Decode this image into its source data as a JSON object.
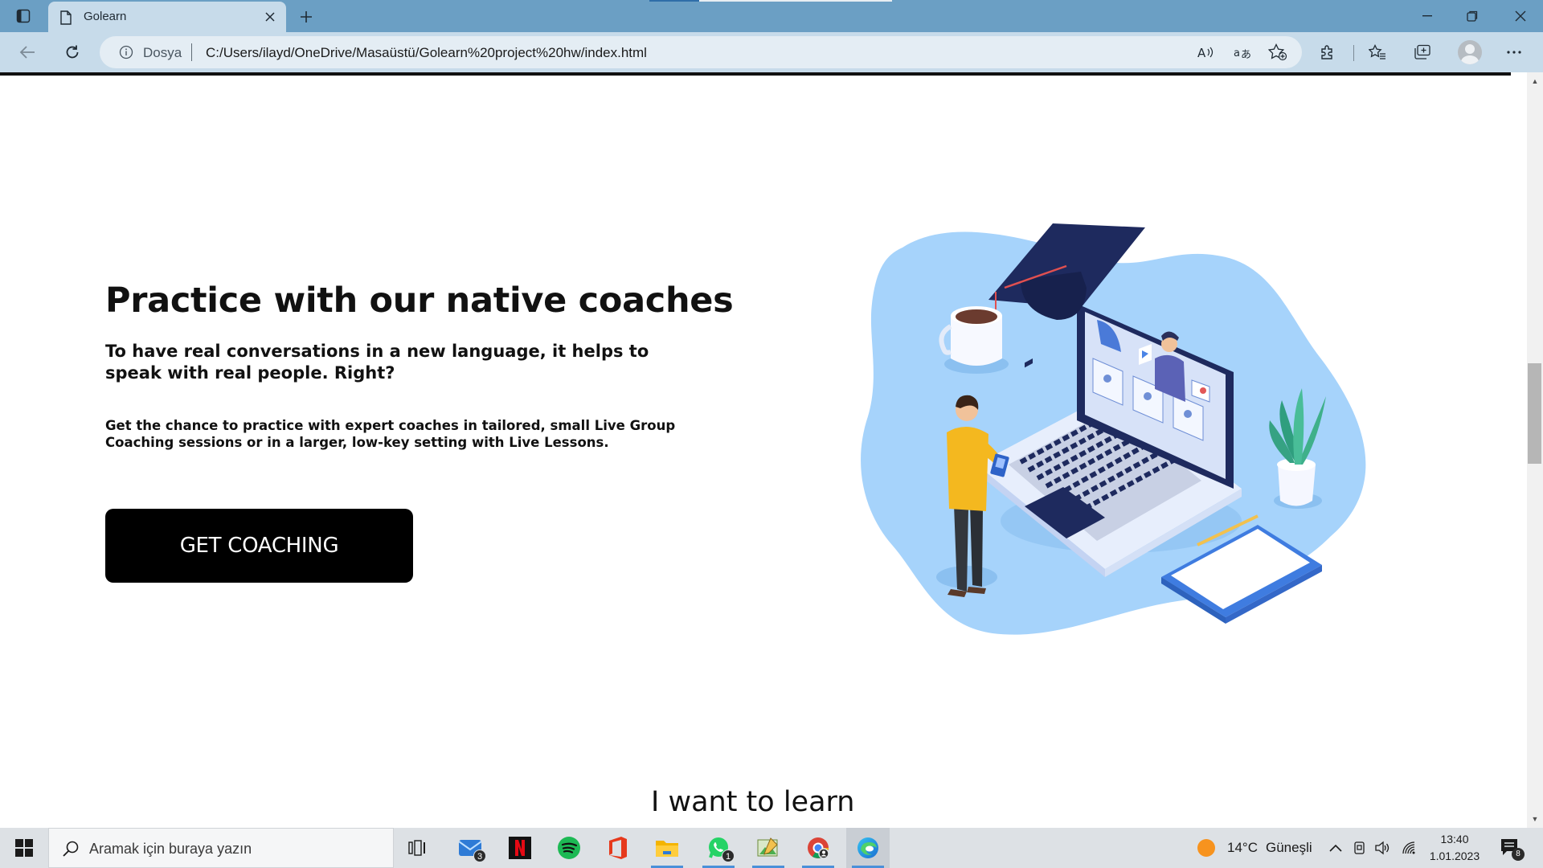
{
  "browser": {
    "tab_title": "Golearn",
    "address_scheme": "Dosya",
    "address_url": "C:/Users/ilayd/OneDrive/Masaüstü/Golearn%20project%20hw/index.html",
    "icons": [
      "tab-actions-icon",
      "page-icon",
      "close-icon",
      "plus-icon",
      "minimize-icon",
      "restore-icon",
      "window-close-icon",
      "back-arrow-icon",
      "refresh-icon",
      "info-icon",
      "read-aloud-icon",
      "translate-icon",
      "add-favorite-icon",
      "extensions-icon",
      "favorites-icon",
      "collections-icon",
      "profile-avatar",
      "more-icon"
    ]
  },
  "page": {
    "heading": "Practice with our native coaches",
    "subheading": "To have real conversations in a new language, it helps to speak with real people. Right?",
    "body": "Get the chance to practice with expert coaches in tailored, small Live Group Coaching sessions or in a larger, low-key setting with Live Lessons.",
    "cta_label": "GET COACHING",
    "next_section_title": "I want to learn"
  },
  "taskbar": {
    "search_placeholder": "Aramak için buraya yazın",
    "apps": [
      {
        "name": "task-view",
        "badge": ""
      },
      {
        "name": "mail",
        "badge": "3"
      },
      {
        "name": "netflix",
        "badge": ""
      },
      {
        "name": "spotify",
        "badge": ""
      },
      {
        "name": "office",
        "badge": ""
      },
      {
        "name": "file-explorer",
        "badge": ""
      },
      {
        "name": "whatsapp",
        "badge": "1"
      },
      {
        "name": "image-viewer",
        "badge": ""
      },
      {
        "name": "chrome",
        "badge": ""
      },
      {
        "name": "edge",
        "badge": ""
      }
    ],
    "weather_temp": "14°C",
    "weather_desc": "Güneşli",
    "time": "13:40",
    "date": "1.01.2023",
    "notification_count": "8"
  },
  "colors": {
    "titlebar": "#6b9fc4",
    "toolbar": "#c7dbea",
    "cta_background": "#000000",
    "illustration_blob": "#a6d3fb",
    "cap_navy": "#1e2a5e"
  }
}
